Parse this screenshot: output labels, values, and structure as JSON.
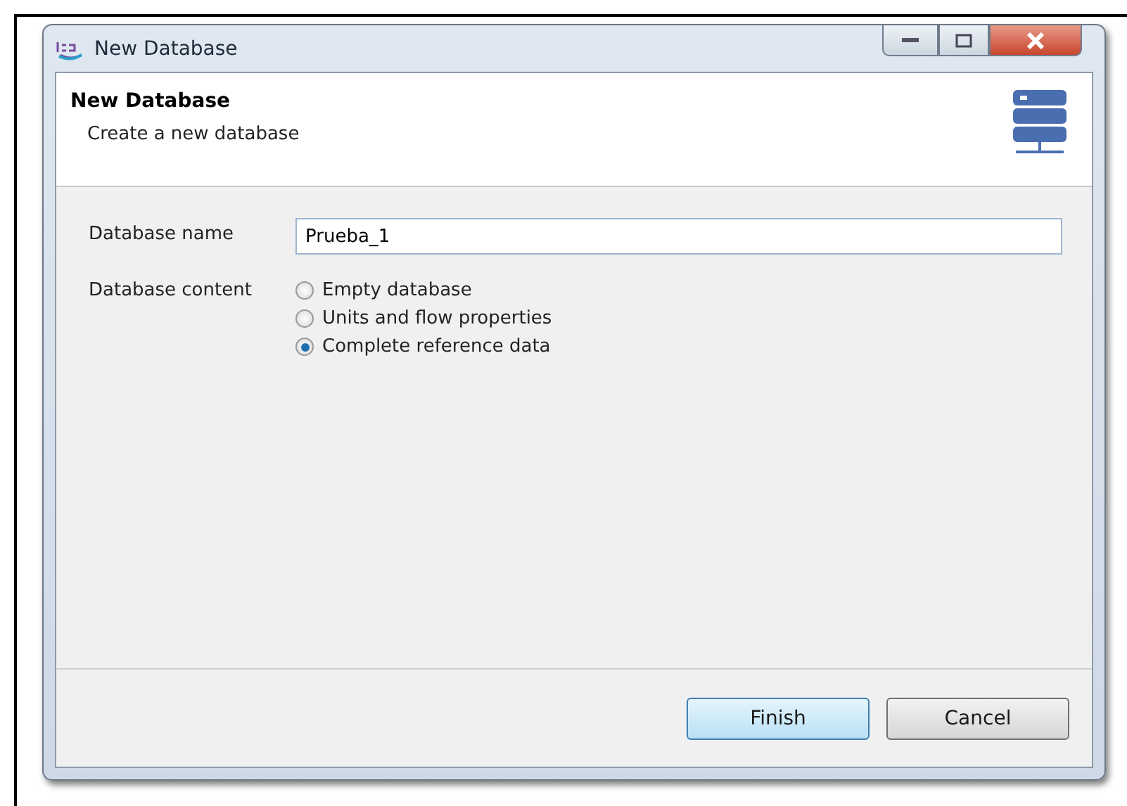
{
  "window": {
    "title": "New Database"
  },
  "header": {
    "title": "New Database",
    "subtitle": "Create a new database"
  },
  "form": {
    "name_label": "Database name",
    "name_value": "Prueba_1",
    "content_label": "Database content",
    "options": [
      {
        "label": "Empty database",
        "selected": false
      },
      {
        "label": "Units and flow properties",
        "selected": false
      },
      {
        "label": "Complete reference data",
        "selected": true
      }
    ]
  },
  "buttons": [
    {
      "label": "Finish",
      "default": true
    },
    {
      "label": "Cancel",
      "default": false
    }
  ]
}
